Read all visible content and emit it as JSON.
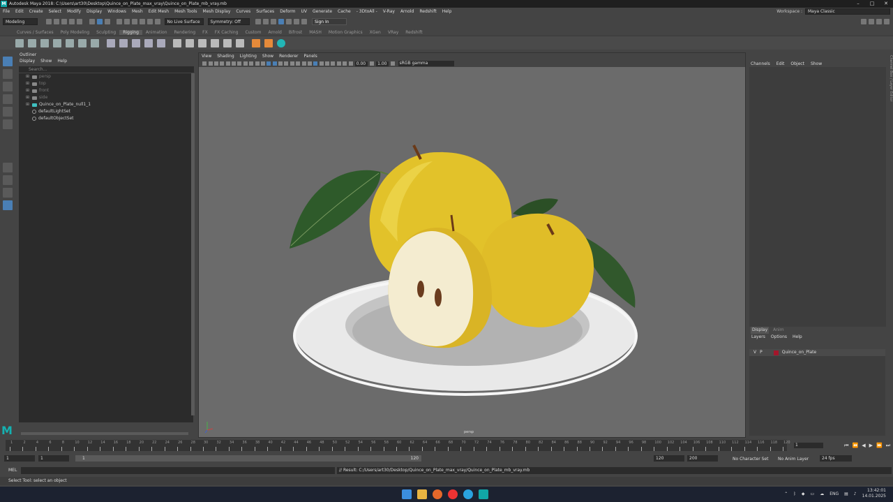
{
  "window": {
    "title": "Autodesk Maya 2018: C:\\Users\\art30\\Desktop\\Quince_on_Plate_max_vray\\Quince_on_Plate_mb_vray.mb",
    "controls": [
      "–",
      "□",
      "✕"
    ]
  },
  "menubar": {
    "items": [
      "File",
      "Edit",
      "Create",
      "Select",
      "Modify",
      "Display",
      "Windows",
      "Mesh",
      "Edit Mesh",
      "Mesh Tools",
      "Mesh Display",
      "Curves",
      "Surfaces",
      "Deform",
      "UV",
      "Generate",
      "Cache",
      "- 3DtoAll -",
      "V-Ray",
      "Arnold",
      "Redshift",
      "Help"
    ],
    "workspace_label": "Workspace :",
    "workspace_value": "Maya Classic"
  },
  "statusline": {
    "menuset": "Modeling",
    "live_surface": "No Live Surface",
    "symmetry": "Symmetry: Off",
    "sign_in": "Sign In"
  },
  "shelf": {
    "tabs": [
      "Curves / Surfaces",
      "Poly Modeling",
      "Sculpting",
      "Rigging",
      "Animation",
      "Rendering",
      "FX",
      "FX Caching",
      "Custom",
      "Arnold",
      "Bifrost",
      "MASH",
      "Motion Graphics",
      "XGen",
      "VRay",
      "Redshift"
    ],
    "active_tab": "Rigging"
  },
  "outliner": {
    "title": "Outliner",
    "menu": [
      "Display",
      "Show",
      "Help"
    ],
    "search_placeholder": "Search...",
    "nodes": [
      {
        "label": "persp",
        "dim": true,
        "icon": "camera-icon"
      },
      {
        "label": "top",
        "dim": true,
        "icon": "camera-icon"
      },
      {
        "label": "front",
        "dim": true,
        "icon": "camera-icon"
      },
      {
        "label": "side",
        "dim": true,
        "icon": "camera-icon"
      },
      {
        "label": "Quince_on_Plate_null1_1",
        "dim": false,
        "icon": "group-icon"
      },
      {
        "label": "defaultLightSet",
        "dim": false,
        "icon": "set-icon"
      },
      {
        "label": "defaultObjectSet",
        "dim": false,
        "icon": "set-icon"
      }
    ]
  },
  "viewport": {
    "menu": [
      "View",
      "Shading",
      "Lighting",
      "Show",
      "Renderer",
      "Panels"
    ],
    "exposure": "0.00",
    "gamma": "1.00",
    "color_space": "sRGB gamma",
    "camera_label": "persp"
  },
  "channelbox": {
    "menu": [
      "Channels",
      "Edit",
      "Object",
      "Show"
    ],
    "side_tab": "Channel Box / Layer Editor"
  },
  "layers": {
    "tabs": [
      "Display",
      "Anim"
    ],
    "menu": [
      "Layers",
      "Options",
      "Help"
    ],
    "rows": [
      {
        "v": "V",
        "p": "P",
        "name": "Quince_on_Plate",
        "color": "#a3162b"
      }
    ]
  },
  "timeslider": {
    "ticks": [
      "1",
      "2",
      "4",
      "6",
      "8",
      "10",
      "12",
      "14",
      "16",
      "18",
      "20",
      "22",
      "24",
      "26",
      "28",
      "30",
      "32",
      "34",
      "36",
      "38",
      "40",
      "42",
      "44",
      "46",
      "48",
      "50",
      "52",
      "54",
      "56",
      "58",
      "60",
      "62",
      "64",
      "66",
      "68",
      "70",
      "72",
      "74",
      "76",
      "78",
      "80",
      "82",
      "84",
      "86",
      "88",
      "90",
      "92",
      "94",
      "96",
      "98",
      "100",
      "102",
      "104",
      "106",
      "108",
      "110",
      "112",
      "114",
      "116",
      "118",
      "120"
    ],
    "current_frame": "1"
  },
  "range": {
    "start": "1",
    "start_inner": "1",
    "bar_start": "1",
    "bar_end": "120",
    "end_inner": "120",
    "end": "200",
    "character_set": "No Character Set",
    "anim_layer": "No Anim Layer",
    "fps": "24 fps"
  },
  "cmdline": {
    "label": "MEL",
    "result": "// Result: C:/Users/art30/Desktop/Quince_on_Plate_max_vray/Quince_on_Plate_mb_vray.mb"
  },
  "helpline": "Select Tool: select an object",
  "taskbar": {
    "lang": "ENG",
    "time": "13:42:01",
    "date": "14.01.2025"
  },
  "colors": {
    "accent": "#4a7fb5",
    "maya_teal": "#11a6a6",
    "quince_yellow": "#e2c22a",
    "layer_color": "#a3162b"
  }
}
